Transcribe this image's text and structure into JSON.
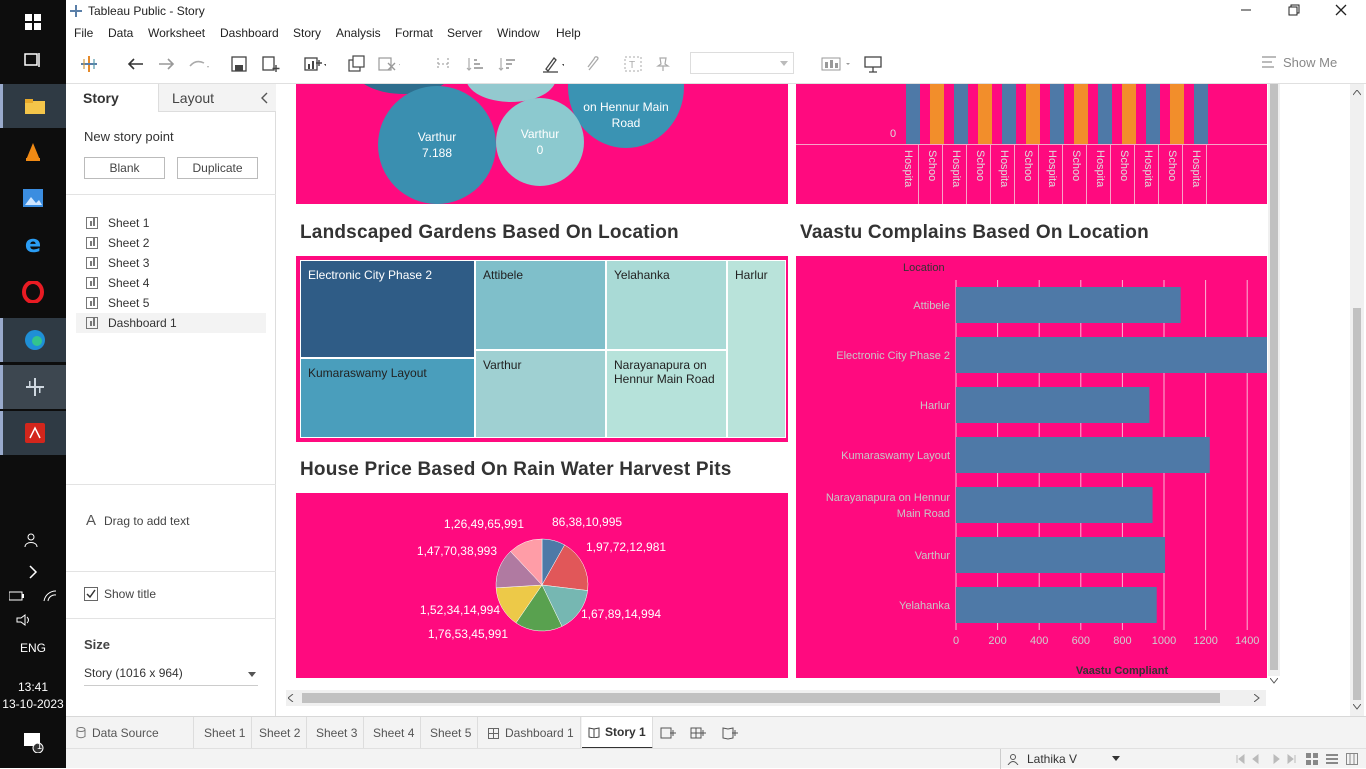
{
  "taskbar": {
    "lang": "ENG",
    "time": "13:41",
    "date": "13-10-2023",
    "notif_count": "1"
  },
  "titlebar": {
    "title": "Tableau Public - Story"
  },
  "menu": {
    "file": "File",
    "data": "Data",
    "worksheet": "Worksheet",
    "dashboard": "Dashboard",
    "story": "Story",
    "analysis": "Analysis",
    "format": "Format",
    "server": "Server",
    "window": "Window",
    "help": "Help"
  },
  "toolbar": {
    "show_me": "Show Me"
  },
  "left": {
    "tab_story": "Story",
    "tab_layout": "Layout",
    "new_story_point": "New story point",
    "blank": "Blank",
    "duplicate": "Duplicate",
    "sheets": [
      "Sheet 1",
      "Sheet 2",
      "Sheet 3",
      "Sheet 4",
      "Sheet 5",
      "Dashboard 1"
    ],
    "drag_text": "Drag to add text",
    "show_title": "Show title",
    "size_label": "Size",
    "size_value": "Story (1016 x 964)"
  },
  "viz": {
    "bubbles": {
      "b1": "on Hennur Main",
      "b1b": "Road",
      "b2": "Varthur",
      "b2v": "7.188",
      "b3": "Varthur",
      "b3v": "0"
    },
    "bar_zero": "0",
    "bar_cats": [
      "Hospita",
      "Schoo",
      "Hospita",
      "Schoo",
      "Hospita",
      "Schoo",
      "Hospita",
      "Schoo",
      "Hospita",
      "Schoo",
      "Hospita",
      "Schoo",
      "Hospita"
    ],
    "gardens_title": "Landscaped Gardens Based On Location",
    "treemap": [
      "Electronic City Phase 2",
      "Attibele",
      "Yelahanka",
      "Harlur",
      "Kumaraswamy Layout",
      "Varthur",
      "Narayanapura on Hennur Main Road"
    ],
    "vaastu_title": "Vaastu Complains Based On Location",
    "house_title": "House Price Based On Rain Water Harvest Pits"
  },
  "chart_data": [
    {
      "type": "bar",
      "orientation": "horizontal",
      "title": "Vaastu Complains Based On Location",
      "ylabel": "Location",
      "xlabel": "Vaastu Compliant",
      "categories": [
        "Attibele",
        "Electronic City Phase 2",
        "Harlur",
        "Kumaraswamy Layout",
        "Narayanapura on Hennur Main Road",
        "Varthur",
        "Yelahanka"
      ],
      "values": [
        1080,
        1540,
        930,
        1220,
        945,
        1005,
        965
      ],
      "xticks": [
        "0",
        "200",
        "400",
        "600",
        "800",
        "1000",
        "1200",
        "1400"
      ],
      "xlim": [
        0,
        1500
      ]
    },
    {
      "type": "pie",
      "title": "House Price Based On Rain Water Harvest Pits",
      "labels": [
        "86,38,10,995",
        "1,97,72,12,981",
        "1,67,89,14,994",
        "1,76,53,45,991",
        "1,52,34,14,994",
        "1,47,70,38,993",
        "1,26,49,65,991"
      ],
      "values": [
        863810995,
        1977212981,
        1678914994,
        1765345991,
        1523414994,
        1477038993,
        1264965991
      ],
      "colors": [
        "#4e79a7",
        "#e15759",
        "#76b7b2",
        "#59a14f",
        "#edc948",
        "#b07aa1",
        "#ff9da7"
      ]
    }
  ],
  "tabs": {
    "data_source": "Data Source",
    "sheets": [
      "Sheet 1",
      "Sheet 2",
      "Sheet 3",
      "Sheet 4",
      "Sheet 5"
    ],
    "dashboard": "Dashboard 1",
    "story": "Story 1"
  },
  "status": {
    "user": "Lathika V"
  }
}
